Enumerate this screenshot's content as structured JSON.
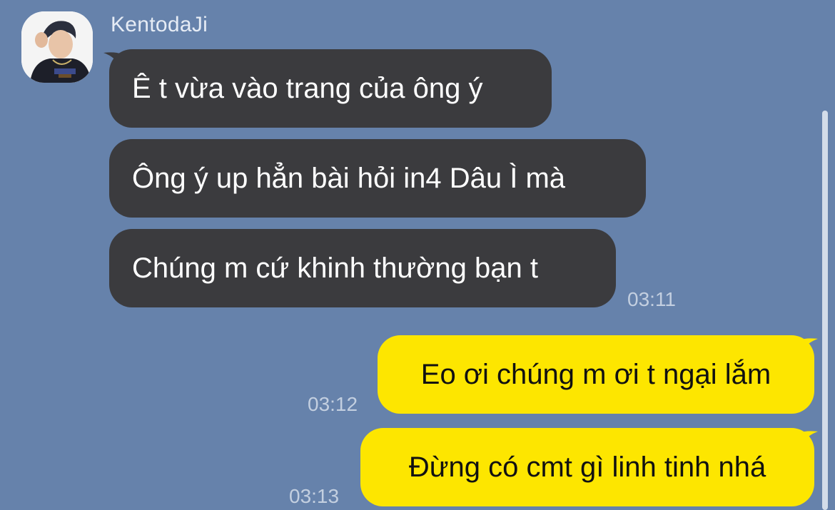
{
  "conversation": {
    "incoming_sender": {
      "name": "KentodaJi",
      "avatar_icon": "profile-photo"
    },
    "incoming_messages": [
      {
        "text": "Ê t vừa vào trang của ông ý"
      },
      {
        "text": "Ông ý up hẳn bài hỏi in4 Dâu Ì mà"
      },
      {
        "text": "Chúng m cứ khinh thường bạn t"
      }
    ],
    "incoming_time": "03:11",
    "outgoing_messages": [
      {
        "text": "Eo ơi chúng m ơi t ngại lắm",
        "time": "03:12"
      },
      {
        "text": "Đừng có cmt gì linh tinh nhá",
        "time": "03:13"
      }
    ]
  },
  "colors": {
    "background": "#6682ab",
    "incoming_bubble": "#3b3b3e",
    "outgoing_bubble": "#fde600",
    "timestamp": "#c3cfe0"
  }
}
